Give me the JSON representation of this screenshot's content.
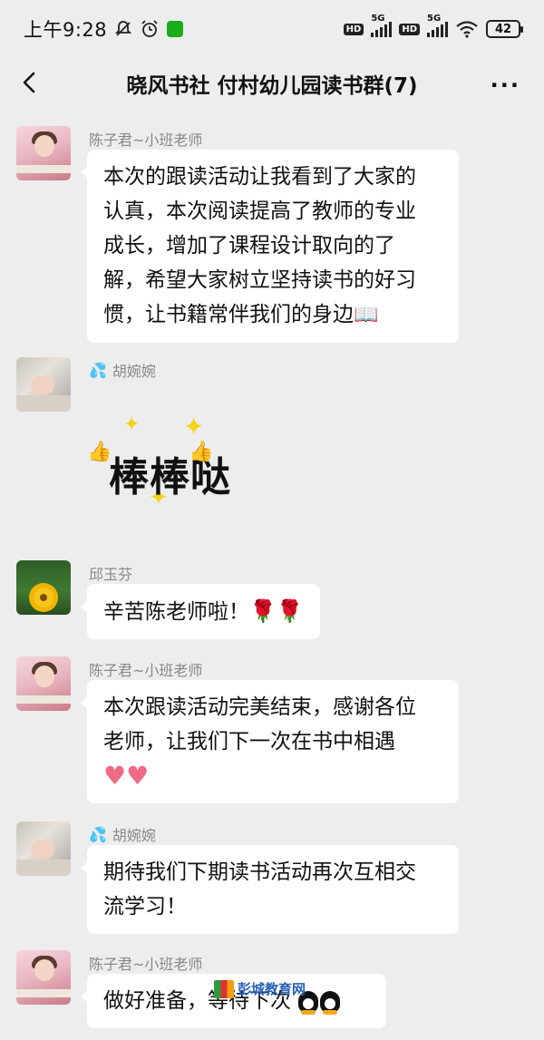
{
  "status_bar": {
    "time": "上午9:28",
    "network_1": "5G",
    "network_2": "5G",
    "battery": "42"
  },
  "nav": {
    "title": "晓风书社 付村幼儿园读书群(7)",
    "more": "···"
  },
  "messages": [
    {
      "sender": "陈子君~小班老师",
      "lines": [
        "本次的跟读活动让我看到了大家的",
        "认真，本次阅读提高了教师的专业",
        "成长，增加了课程设计取向的了",
        "解，希望大家树立坚持读书的好习",
        "惯，让书籍常伴我们的身边"
      ],
      "trailing_emoji": "📖"
    },
    {
      "sender": "胡婉婉",
      "sticker_text": "棒棒哒"
    },
    {
      "sender": "邱玉芬",
      "text": "辛苦陈老师啦！",
      "trailing_emoji": "🌹🌹"
    },
    {
      "sender": "陈子君~小班老师",
      "lines": [
        "本次跟读活动完美结束，感谢各位",
        "老师，让我们下一次在书中相遇"
      ],
      "trailing_emoji": "♥♥"
    },
    {
      "sender": "胡婉婉",
      "lines": [
        "期待我们下期读书活动再次互相交",
        "流学习！"
      ]
    },
    {
      "sender": "陈子君~小班老师",
      "text": "做好准备，等待下次"
    }
  ],
  "watermark": "彭城教育网",
  "colors": {
    "background": "#ededed",
    "bubble": "#ffffff",
    "sender_text": "#888888"
  }
}
